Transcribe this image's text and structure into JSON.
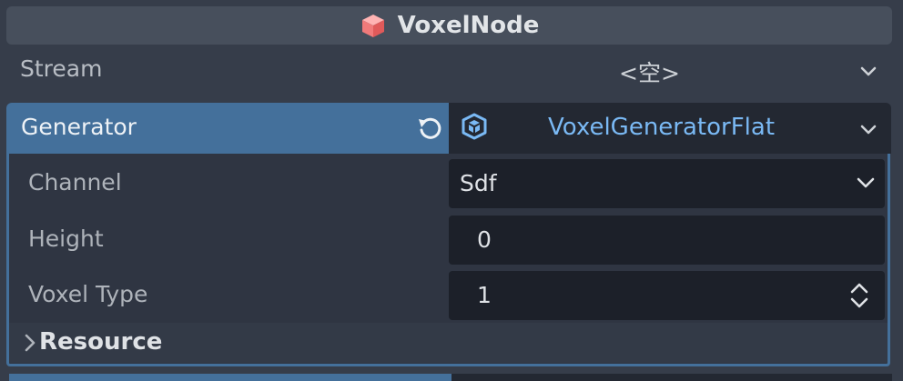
{
  "header": {
    "title": "VoxelNode",
    "icon": "voxel-node-cube-icon"
  },
  "stream": {
    "label": "Stream",
    "value": "<空>"
  },
  "generator": {
    "label": "Generator",
    "value": "VoxelGeneratorFlat",
    "value_color": "#7ab9f4",
    "accent": "#44709b"
  },
  "properties": [
    {
      "label": "Channel",
      "value": "Sdf",
      "control": "dropdown"
    },
    {
      "label": "Height",
      "value": "0",
      "control": "number"
    },
    {
      "label": "Voxel Type",
      "value": "1",
      "control": "spinbox"
    }
  ],
  "resource": {
    "label": "Resource"
  }
}
